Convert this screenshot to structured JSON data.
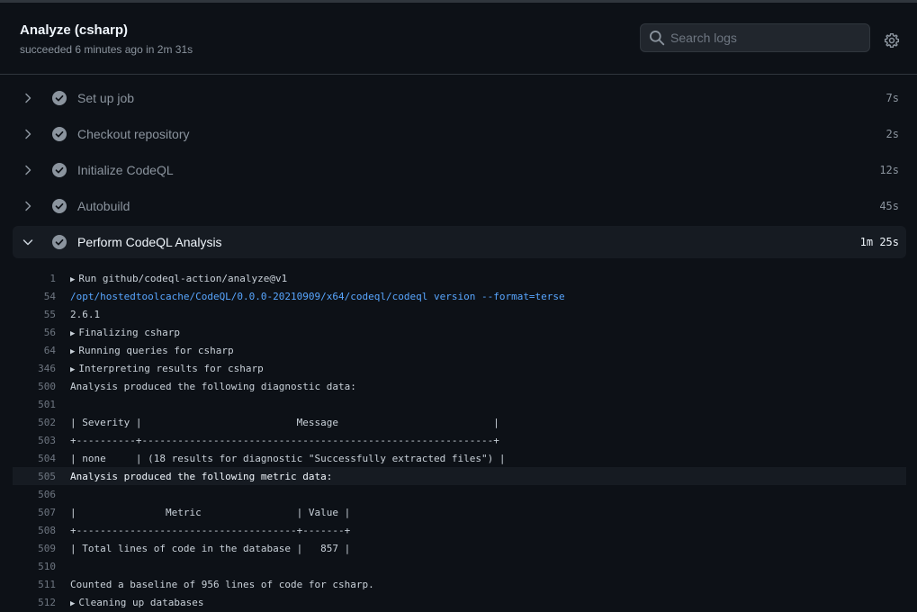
{
  "header": {
    "title": "Analyze (csharp)",
    "subtitle": "succeeded 6 minutes ago in 2m 31s",
    "search_placeholder": "Search logs"
  },
  "steps": [
    {
      "name": "Set up job",
      "duration": "7s",
      "expanded": false
    },
    {
      "name": "Checkout repository",
      "duration": "2s",
      "expanded": false
    },
    {
      "name": "Initialize CodeQL",
      "duration": "12s",
      "expanded": false
    },
    {
      "name": "Autobuild",
      "duration": "45s",
      "expanded": false
    },
    {
      "name": "Perform CodeQL Analysis",
      "duration": "1m 25s",
      "expanded": true
    }
  ],
  "log_lines": [
    {
      "n": "1",
      "text": "Run github/codeql-action/analyze@v1",
      "collapsible": true,
      "kind": "normal"
    },
    {
      "n": "54",
      "text": "/opt/hostedtoolcache/CodeQL/0.0.0-20210909/x64/codeql/codeql version --format=terse",
      "collapsible": false,
      "kind": "cmd"
    },
    {
      "n": "55",
      "text": "2.6.1",
      "collapsible": false,
      "kind": "normal"
    },
    {
      "n": "56",
      "text": "Finalizing csharp",
      "collapsible": true,
      "kind": "normal"
    },
    {
      "n": "64",
      "text": "Running queries for csharp",
      "collapsible": true,
      "kind": "normal"
    },
    {
      "n": "346",
      "text": "Interpreting results for csharp",
      "collapsible": true,
      "kind": "normal"
    },
    {
      "n": "500",
      "text": "Analysis produced the following diagnostic data:",
      "collapsible": false,
      "kind": "normal"
    },
    {
      "n": "501",
      "text": "",
      "collapsible": false,
      "kind": "normal"
    },
    {
      "n": "502",
      "text": "| Severity |                          Message                          |",
      "collapsible": false,
      "kind": "normal"
    },
    {
      "n": "503",
      "text": "+----------+-----------------------------------------------------------+",
      "collapsible": false,
      "kind": "normal"
    },
    {
      "n": "504",
      "text": "| none     | (18 results for diagnostic \"Successfully extracted files\") |",
      "collapsible": false,
      "kind": "normal"
    },
    {
      "n": "505",
      "text": "Analysis produced the following metric data:",
      "collapsible": false,
      "kind": "highlight"
    },
    {
      "n": "506",
      "text": "",
      "collapsible": false,
      "kind": "normal"
    },
    {
      "n": "507",
      "text": "|               Metric                | Value |",
      "collapsible": false,
      "kind": "normal"
    },
    {
      "n": "508",
      "text": "+-------------------------------------+-------+",
      "collapsible": false,
      "kind": "normal"
    },
    {
      "n": "509",
      "text": "| Total lines of code in the database |   857 |",
      "collapsible": false,
      "kind": "normal"
    },
    {
      "n": "510",
      "text": "",
      "collapsible": false,
      "kind": "normal"
    },
    {
      "n": "511",
      "text": "Counted a baseline of 956 lines of code for csharp.",
      "collapsible": false,
      "kind": "normal"
    },
    {
      "n": "512",
      "text": "Cleaning up databases",
      "collapsible": true,
      "kind": "normal"
    }
  ],
  "icons": {
    "search": "search-icon",
    "settings": "gear-icon",
    "success": "check-circle-icon",
    "collapse": "chevron-right-icon",
    "expand": "chevron-down-icon"
  },
  "colors": {
    "background": "#0d1117",
    "command_link": "#58a6ff",
    "success_icon": "#8b949e"
  }
}
